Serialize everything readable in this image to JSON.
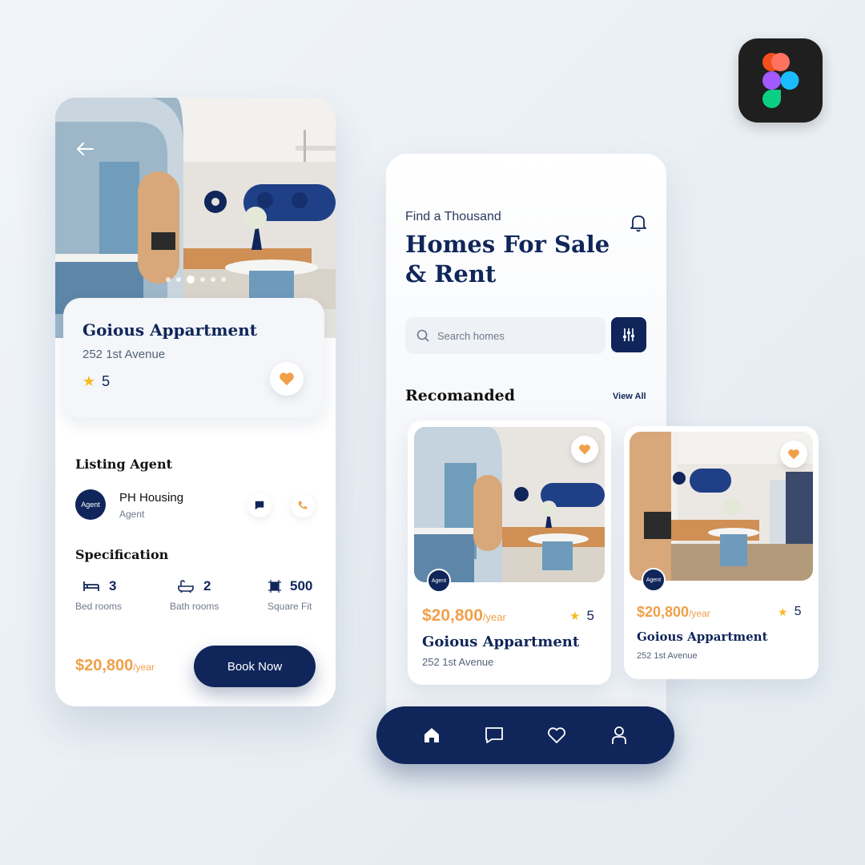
{
  "detail": {
    "title": "Goious Appartment",
    "address": "252 1st Avenue",
    "rating": "5",
    "listing_agent_heading": "Listing Agent",
    "agent_avatar_label": "Agent",
    "agent_name": "PH Housing",
    "agent_role": "Agent",
    "specification_heading": "Specification",
    "specs": [
      {
        "icon": "bed-icon",
        "value": "3",
        "label": "Bed rooms"
      },
      {
        "icon": "bath-icon",
        "value": "2",
        "label": "Bath rooms"
      },
      {
        "icon": "area-icon",
        "value": "500",
        "label": "Square Fit"
      }
    ],
    "price": "$20,800",
    "price_unit": "/year",
    "book_label": "Book Now",
    "carousel_active_index": 2,
    "carousel_count": 6
  },
  "home": {
    "subtitle": "Find a Thousand",
    "title_line1": "Homes For Sale",
    "title_line2": "& Rent",
    "search_placeholder": "Search homes",
    "section_title": "Recomanded",
    "view_all": "View All",
    "cards": [
      {
        "price": "$20,800",
        "price_unit": "/year",
        "rating": "5",
        "title": "Goious Appartment",
        "address": "252 1st Avenue",
        "avatar_label": "Agent"
      },
      {
        "price": "$20,800",
        "price_unit": "/year",
        "rating": "5",
        "title": "Goious Appartment",
        "address": "252 1st Avenue",
        "avatar_label": "Agent"
      }
    ],
    "nav": [
      "home-icon",
      "chat-icon",
      "heart-icon",
      "user-icon"
    ]
  },
  "colors": {
    "navy": "#10265a",
    "accent_orange": "#f0a04b",
    "star_yellow": "#f7b924"
  }
}
